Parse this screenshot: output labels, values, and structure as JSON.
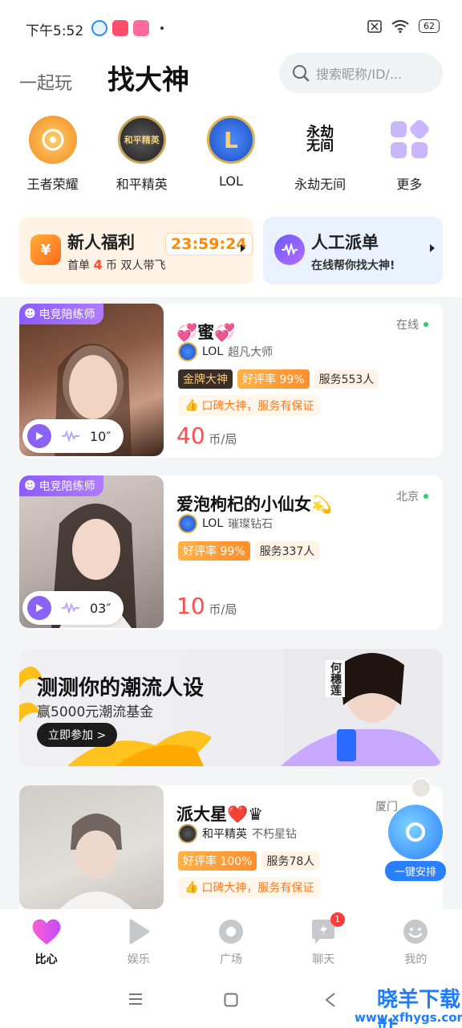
{
  "status_bar": {
    "time": "下午5:52",
    "battery": "62"
  },
  "header": {
    "tab_secondary": "一起玩",
    "tab_primary": "找大神",
    "search_placeholder": "搜索昵称/ID/..."
  },
  "games": [
    {
      "label": "王者荣耀",
      "icon": "honor-of-kings-icon",
      "color": "#f6a23b"
    },
    {
      "label": "和平精英",
      "icon": "peace-elite-icon",
      "color": "#3a3a3a"
    },
    {
      "label": "LOL",
      "icon": "lol-icon",
      "color": "#2f6fe0"
    },
    {
      "label": "永劫无间",
      "icon": "naraka-icon",
      "color": "#222222"
    },
    {
      "label": "更多",
      "icon": "more-grid-icon",
      "color": "#c9b6ff"
    }
  ],
  "promos": {
    "newbie": {
      "title": "新人福利",
      "timer": "23:59:24",
      "sub_prefix": "首单",
      "sub_num": "4",
      "sub_suffix": "币 双人带飞"
    },
    "dispatch": {
      "title": "人工派单",
      "sub": "在线帮你找大神!"
    }
  },
  "players": [
    {
      "badge": "电竞陪练师",
      "voice_duration": "10″",
      "name": "💞蜜💞",
      "location": "在线",
      "game": "LOL",
      "rank": "超凡大师",
      "tags": [
        "金牌大神",
        "好评率 99%",
        "服务553人"
      ],
      "trust": "口碑大神，服务有保证",
      "price": "40",
      "price_unit": "币/局"
    },
    {
      "badge": "电竞陪练师",
      "voice_duration": "03″",
      "name": "爱泡枸杞的小仙女💫",
      "location": "北京",
      "game": "LOL",
      "rank": "璀璨钻石",
      "tags": [
        "好评率 99%",
        "服务337人"
      ],
      "price": "10",
      "price_unit": "币/局"
    },
    {
      "name": "派大星❤️♛",
      "location": "厦门",
      "game": "和平精英",
      "rank": "不朽星钻",
      "tags": [
        "好评率 100%",
        "服务78人"
      ],
      "trust": "口碑大神，服务有保证"
    }
  ],
  "banner": {
    "title": "测测你的潮流人设",
    "sub": "赢5000元潮流基金",
    "button": "立即参加 >",
    "star_name": "何穗莲"
  },
  "float_button": {
    "label": "一键安排"
  },
  "bottom_nav": [
    {
      "label": "比心",
      "icon": "heart-icon",
      "active": true
    },
    {
      "label": "娱乐",
      "icon": "play-icon"
    },
    {
      "label": "广场",
      "icon": "circle-icon"
    },
    {
      "label": "聊天",
      "icon": "chat-icon",
      "badge": "1"
    },
    {
      "label": "我的",
      "icon": "face-icon"
    }
  ],
  "watermark": {
    "title": "晓羊下载站",
    "url": "www.xfhygs.com"
  },
  "colors": {
    "accent_purple": "#8a63f5",
    "price_red": "#ff4d4d",
    "rate_orange": "#ff8e2b",
    "heart_pink": "#ff4fa6"
  }
}
